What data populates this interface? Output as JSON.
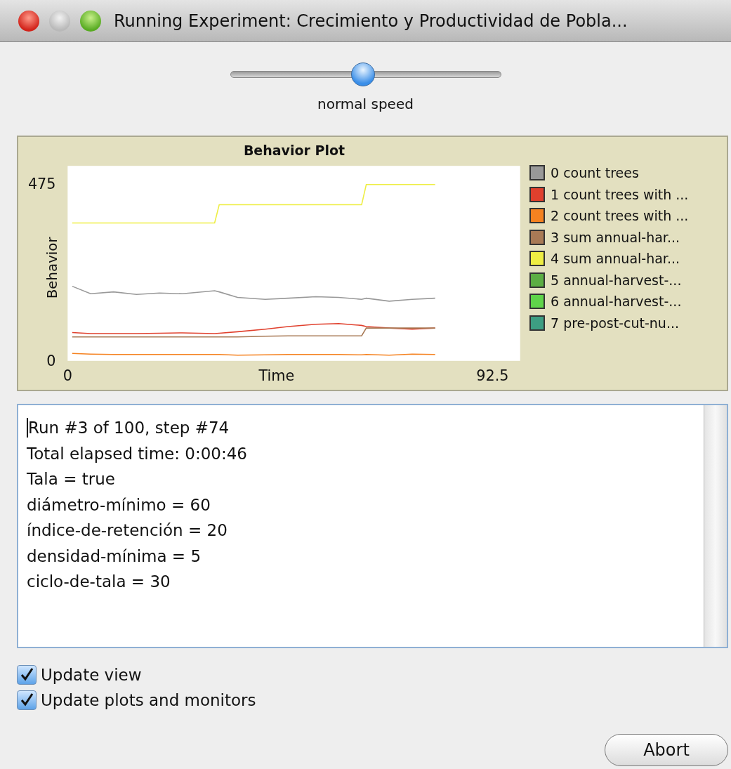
{
  "window": {
    "title": "Running Experiment: Crecimiento y Productividad de Pobla..."
  },
  "speed_slider": {
    "level": 0.49,
    "label": "normal speed"
  },
  "plot": {
    "chart_data": {
      "type": "line",
      "title": "Behavior Plot",
      "xlabel": "Time",
      "ylabel": "Behavior",
      "x": [
        1,
        5,
        10,
        15,
        20,
        25,
        32,
        33,
        37,
        43,
        48,
        54,
        59,
        64,
        65,
        70,
        75,
        80
      ],
      "xlim": [
        0,
        98.5
      ],
      "ylim": [
        0,
        523
      ],
      "xticks": [
        0,
        92.5
      ],
      "yticks": [
        0,
        475
      ],
      "legend": "right",
      "series": [
        {
          "name": "0 count trees",
          "color": "#999999",
          "values": [
            200,
            180,
            185,
            178,
            182,
            180,
            188,
            185,
            170,
            165,
            168,
            172,
            170,
            165,
            168,
            160,
            165,
            168
          ]
        },
        {
          "name": "1 count trees with ...",
          "color": "#e0402d",
          "values": [
            76,
            73,
            73,
            73,
            74,
            75,
            73,
            74,
            78,
            85,
            92,
            98,
            100,
            95,
            92,
            88,
            85,
            88
          ]
        },
        {
          "name": "2 count trees with ...",
          "color": "#f58220",
          "values": [
            20,
            18,
            17,
            17,
            17,
            17,
            17,
            17,
            15,
            16,
            17,
            17,
            17,
            16,
            17,
            15,
            18,
            17
          ]
        },
        {
          "name": "3 sum annual-har...",
          "color": "#a87a56",
          "values": [
            64,
            64,
            64,
            64,
            64,
            64,
            64,
            64,
            64,
            66,
            67,
            67,
            67,
            67,
            88,
            88,
            88,
            88
          ]
        },
        {
          "name": "4 sum annual-har...",
          "color": "#eeee44",
          "values": [
            370,
            370,
            370,
            370,
            370,
            370,
            370,
            419,
            419,
            419,
            419,
            419,
            419,
            419,
            473,
            473,
            473,
            473
          ]
        },
        {
          "name": "5 annual-harvest-...",
          "color": "#5cae44",
          "values": [
            null,
            null,
            null,
            null,
            null,
            null,
            null,
            null,
            null,
            null,
            null,
            null,
            null,
            null,
            null,
            null,
            null,
            null
          ]
        },
        {
          "name": "6 annual-harvest-...",
          "color": "#5fd44a",
          "values": [
            null,
            null,
            null,
            null,
            null,
            null,
            null,
            null,
            null,
            null,
            null,
            null,
            null,
            null,
            null,
            null,
            null,
            null
          ]
        },
        {
          "name": "7 pre-post-cut-nu...",
          "color": "#3d9e82",
          "values": [
            null,
            null,
            null,
            null,
            null,
            null,
            null,
            null,
            null,
            null,
            null,
            null,
            null,
            null,
            null,
            null,
            null,
            null
          ]
        }
      ]
    }
  },
  "output_lines": [
    "Run #3 of 100, step #74",
    "Total elapsed time: 0:00:46",
    "Tala = true",
    "diámetro-mínimo = 60",
    "índice-de-retención = 20",
    "densidad-mínima = 5",
    "ciclo-de-tala = 30"
  ],
  "options": [
    {
      "label": "Update view",
      "checked": true
    },
    {
      "label": "Update plots and monitors",
      "checked": true
    }
  ],
  "buttons": [
    "Abort"
  ]
}
